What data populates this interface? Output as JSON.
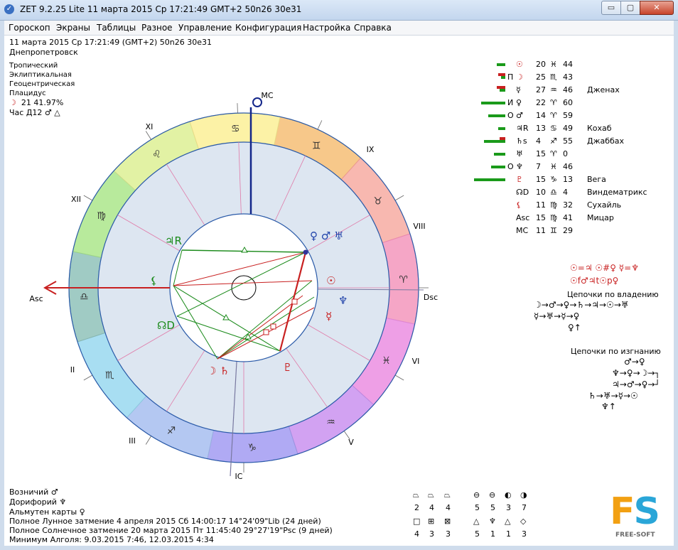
{
  "window": {
    "title": "ZET 9.2.25 Lite    11 марта 2015  Ср  17:21:49 GMT+2 50n26  30e31",
    "min": "▭",
    "max": "▢",
    "close": "✕"
  },
  "menu": [
    "Гороскоп",
    "Экраны",
    "Таблицы",
    "Разное",
    "Управление",
    "Конфигурация",
    "Настройка",
    "Справка"
  ],
  "header": {
    "date_line": "11 марта 2015  Ср  17:21:49 (GMT+2)  50n26  30e31",
    "city": "Днепропетровск"
  },
  "settings": [
    "Тропический",
    "Эклиптикальная",
    "Геоцентрическая",
    "Плацидус"
  ],
  "moon_phase": {
    "symbol": "☽",
    "value": "21  41.97%"
  },
  "hour_ruler": {
    "label": "Час Д12",
    "symbols": "♂ △"
  },
  "planets": [
    {
      "ind": "",
      "sym": "☉",
      "deg": "20",
      "sign": "♓",
      "min": "44",
      "star": ""
    },
    {
      "ind": "П",
      "sym": "☽",
      "deg": "25",
      "sign": "♏",
      "min": "43",
      "star": ""
    },
    {
      "ind": "",
      "sym": "☿",
      "deg": "27",
      "sign": "♒",
      "min": "46",
      "star": "Дженах"
    },
    {
      "ind": "И",
      "sym": "♀",
      "deg": "22",
      "sign": "♈",
      "min": "60",
      "star": ""
    },
    {
      "ind": "О",
      "sym": "♂",
      "deg": "14",
      "sign": "♈",
      "min": "59",
      "star": ""
    },
    {
      "ind": "",
      "sym": "♃R",
      "deg": "13",
      "sign": "♋",
      "min": "49",
      "star": "Кохаб"
    },
    {
      "ind": "",
      "sym": "♄s",
      "deg": "4",
      "sign": "♐",
      "min": "55",
      "star": "Джаббах"
    },
    {
      "ind": "",
      "sym": "♅",
      "deg": "15",
      "sign": "♈",
      "min": "0",
      "star": ""
    },
    {
      "ind": "О",
      "sym": "♆",
      "deg": "7",
      "sign": "♓",
      "min": "46",
      "star": ""
    },
    {
      "ind": "",
      "sym": "♇",
      "deg": "15",
      "sign": "♑",
      "min": "13",
      "star": "Вега"
    },
    {
      "ind": "",
      "sym": "☊D",
      "deg": "10",
      "sign": "♎",
      "min": "4",
      "star": "Виндематрикс"
    },
    {
      "ind": "",
      "sym": "⚸",
      "deg": "11",
      "sign": "♍",
      "min": "32",
      "star": "Сухайль"
    },
    {
      "ind": "",
      "sym": "Asc",
      "deg": "15",
      "sign": "♍",
      "min": "41",
      "star": "Мицар"
    },
    {
      "ind": "",
      "sym": "MC",
      "deg": "11",
      "sign": "♊",
      "min": "29",
      "star": ""
    }
  ],
  "receptions": {
    "line1": "☉=♃ ☉#♀ ☿=♆",
    "line2": "☉f♂♃t☉p♀"
  },
  "chains_ownership": {
    "title": "Цепочки по владению",
    "rows": [
      "☽→♂→♀→♄→♃→☉→♅",
      "☿→♅→☿→♀",
      "♀↑"
    ]
  },
  "chains_exile": {
    "title": "Цепочки по изгнанию",
    "rows": [
      "♂→♀",
      "♆→♀→☽→┐",
      "♃→♂→♀→┘",
      "♄→♅→☿→☉",
      "♆↑"
    ]
  },
  "chart": {
    "houses": [
      "IX",
      "VIII",
      "Dsc",
      "VI",
      "V",
      "IC",
      "III",
      "II",
      "Asc",
      "XII",
      "XI",
      "MC"
    ],
    "signs": [
      "♊",
      "♉",
      "♈",
      "♓",
      "♒",
      "♑",
      "♐",
      "♏",
      "♎",
      "♍",
      "♌",
      "♋"
    ],
    "inner_planets": [
      "♀ ♂ ♅",
      "☉",
      "♆",
      "☿",
      "♇",
      "☽ ♄",
      "☊D",
      "⚸",
      "♃R"
    ]
  },
  "bottom": {
    "vozn": "Возничий  ♂",
    "dorif": "Дорифорий  ♆",
    "almuten": "Альмутен карты  ♀",
    "lunar": "Полное Лунное затмение 4 апреля 2015 Сб 14:00:17 14°24'09\"Lib (24 дней)",
    "solar": "Полное Солнечное затмение 20 марта 2015 Пт 11:45:40 29°27'19\"Psc (9 дней)",
    "algol": "Минимум Алголя: 9.03.2015  7:46,  12.03.2015  4:34"
  },
  "elements": {
    "row1_sym": [
      "⏢",
      "⏢",
      "⏢",
      "⊖",
      "⊖",
      "◐",
      "◑"
    ],
    "row1_num": [
      "2",
      "4",
      "4",
      "5",
      "5",
      "3",
      "7"
    ],
    "row2_sym": [
      "□",
      "⊞",
      "⊠",
      "△",
      "♆",
      "△",
      "◇"
    ],
    "row2_num": [
      "4",
      "3",
      "3",
      "5",
      "1",
      "1",
      "3"
    ]
  },
  "logo": {
    "letters_f": "F",
    "letters_s": "S",
    "sub": "FREE-SOFT"
  }
}
